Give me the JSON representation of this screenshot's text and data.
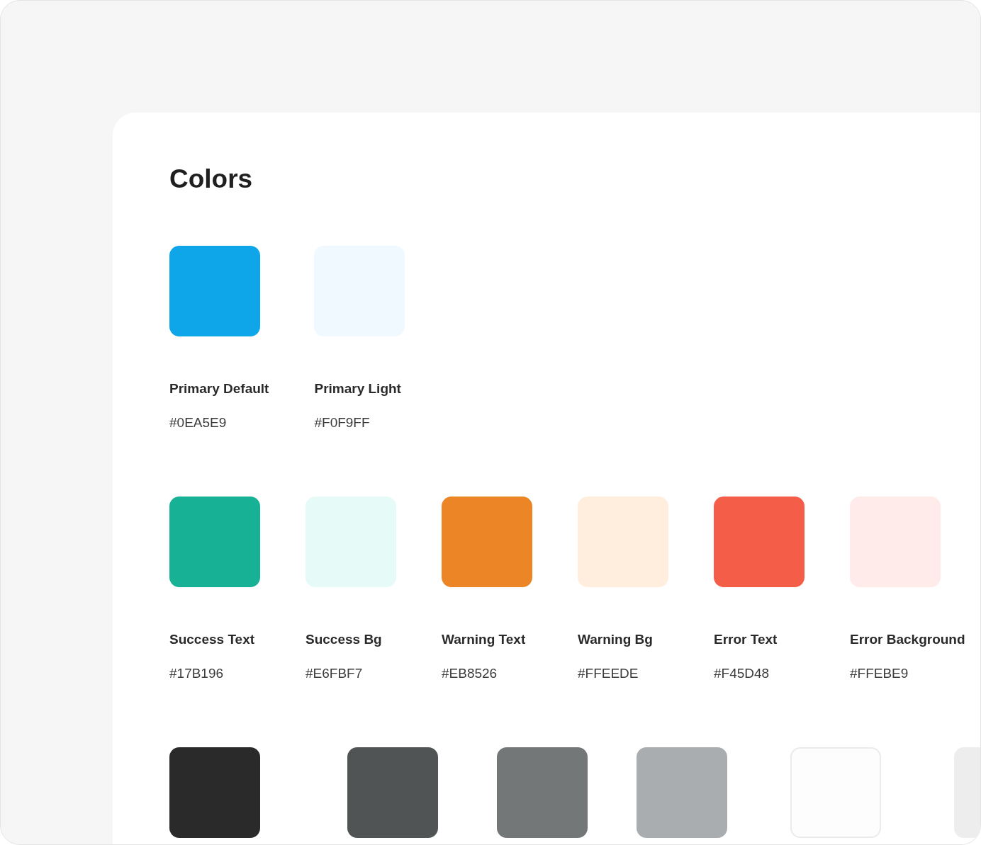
{
  "title": "Colors",
  "rows": [
    {
      "swatches": [
        {
          "name": "Primary Default",
          "hex": "#0EA5E9",
          "color": "#0ea5e9"
        },
        {
          "name": "Primary Light",
          "hex": "#F0F9FF",
          "color": "#f0f9ff"
        }
      ]
    },
    {
      "swatches": [
        {
          "name": "Success Text",
          "hex": "#17B196",
          "color": "#17b196"
        },
        {
          "name": "Success Bg",
          "hex": "#E6FBF7",
          "color": "#e6fbf7"
        },
        {
          "name": "Warning Text",
          "hex": "#EB8526",
          "color": "#eb8526"
        },
        {
          "name": "Warning Bg",
          "hex": "#FFEEDE",
          "color": "#ffeede"
        },
        {
          "name": "Error Text",
          "hex": "#F45D48",
          "color": "#f45d48"
        },
        {
          "name": "Error Background",
          "hex": "#FFEBE9",
          "color": "#ffebe9"
        }
      ]
    },
    {
      "swatches": [
        {
          "color": "#2a2a2a"
        },
        {
          "color": "#505454"
        },
        {
          "color": "#747778"
        },
        {
          "color": "#aaadaf"
        },
        {
          "color": "#fdfdfd"
        },
        {
          "color": "#ededed"
        }
      ]
    }
  ]
}
